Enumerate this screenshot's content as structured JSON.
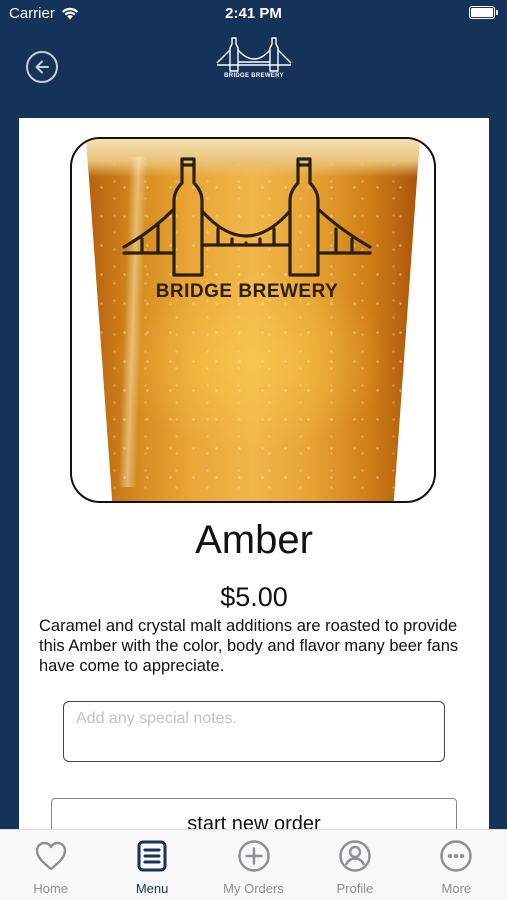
{
  "status_bar": {
    "carrier": "Carrier",
    "time": "2:41 PM"
  },
  "header": {
    "brand": "BRIDGE BREWERY"
  },
  "product": {
    "image_brand": "BRIDGE BREWERY",
    "name": "Amber",
    "price": "$5.00",
    "description": "Caramel and crystal malt additions are roasted to provide this Amber with the color, body and flavor many beer fans have come to appreciate."
  },
  "notes": {
    "placeholder": "Add any special notes.",
    "value": ""
  },
  "actions": {
    "start_order_label": "start new order"
  },
  "tabs": [
    {
      "label": "Home",
      "icon": "heart-icon",
      "active": false
    },
    {
      "label": "Menu",
      "icon": "menu-list-icon",
      "active": true
    },
    {
      "label": "My Orders",
      "icon": "plus-circle-icon",
      "active": false
    },
    {
      "label": "Profile",
      "icon": "profile-icon",
      "active": false
    },
    {
      "label": "More",
      "icon": "more-icon",
      "active": false
    }
  ],
  "colors": {
    "navy": "#153259",
    "inactive_tab": "#8e8e93",
    "tab_bar_bg": "#f8f8f8"
  }
}
